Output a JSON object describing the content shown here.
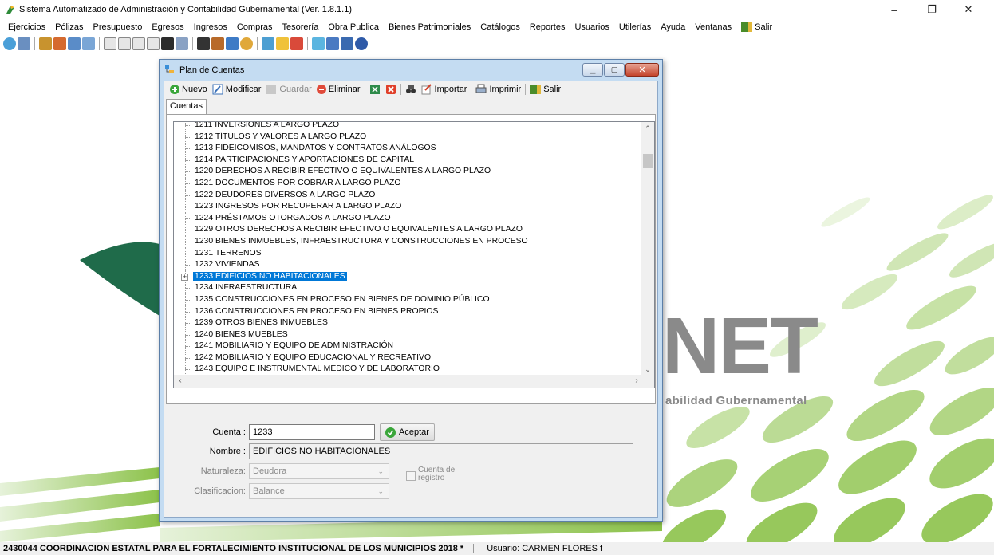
{
  "window": {
    "title": "Sistema Automatizado de Administración y Contabilidad Gubernamental (Ver. 1.8.1.1)"
  },
  "menu": [
    "Ejercicios",
    "Pólizas",
    "Presupuesto",
    "Egresos",
    "Ingresos",
    "Compras",
    "Tesorería",
    "Obra Publica",
    "Bienes Patrimoniales",
    "Catálogos",
    "Reportes",
    "Usuarios",
    "Utilerías",
    "Ayuda",
    "Ventanas"
  ],
  "menu_salir": "Salir",
  "background": {
    "brand_big": "NET",
    "brand_text": "abilidad Gubernamental"
  },
  "dialog": {
    "title": "Plan de Cuentas",
    "toolbar": {
      "nuevo": "Nuevo",
      "modificar": "Modificar",
      "guardar": "Guardar",
      "eliminar": "Eliminar",
      "importar": "Importar",
      "imprimir": "Imprimir",
      "salir": "Salir"
    },
    "tab": "Cuentas",
    "tree_rows": [
      "1211  INVERSIONES A LARGO PLAZO",
      "1212  TÍTULOS Y VALORES A LARGO PLAZO",
      "1213  FIDEICOMISOS, MANDATOS Y CONTRATOS ANÁLOGOS",
      "1214  PARTICIPACIONES Y APORTACIONES DE CAPITAL",
      "1220  DERECHOS A RECIBIR EFECTIVO O EQUIVALENTES A LARGO PLAZO",
      "1221  DOCUMENTOS POR COBRAR A LARGO PLAZO",
      "1222  DEUDORES DIVERSOS A LARGO PLAZO",
      "1223  INGRESOS POR RECUPERAR A LARGO PLAZO",
      "1224  PRÉSTAMOS OTORGADOS A LARGO PLAZO",
      "1229  OTROS DERECHOS A RECIBIR EFECTIVO O EQUIVALENTES A LARGO PLAZO",
      "1230  BIENES INMUEBLES, INFRAESTRUCTURA Y CONSTRUCCIONES EN PROCESO",
      "1231  TERRENOS",
      "1232  VIVIENDAS",
      "1233  EDIFICIOS NO HABITACIONALES",
      "1234  INFRAESTRUCTURA",
      "1235  CONSTRUCCIONES EN PROCESO EN BIENES DE DOMINIO PÚBLICO",
      "1236  CONSTRUCCIONES EN PROCESO EN BIENES PROPIOS",
      "1239  OTROS BIENES INMUEBLES",
      "1240  BIENES MUEBLES",
      "1241  MOBILIARIO Y EQUIPO DE ADMINISTRACIÓN",
      "1242  MOBILIARIO Y EQUIPO EDUCACIONAL Y RECREATIVO",
      "1243  EQUIPO E INSTRUMENTAL MÉDICO Y DE LABORATORIO"
    ],
    "selected_row": 13,
    "form": {
      "cuenta_label": "Cuenta :",
      "cuenta_value": "1233",
      "aceptar": "Aceptar",
      "nombre_label": "Nombre :",
      "nombre_value": "EDIFICIOS NO HABITACIONALES",
      "naturaleza_label": "Naturaleza:",
      "naturaleza_value": "Deudora",
      "clasificacion_label": "Clasificacion:",
      "clasificacion_value": "Balance",
      "cuenta_registro_label": "Cuenta de registro"
    }
  },
  "status": {
    "org": "2430044 COORDINACION ESTATAL PARA EL FORTALECIMIENTO INSTITUCIONAL DE LOS MUNICIPIOS  2018  *",
    "user": "Usuario: CARMEN FLORES f"
  },
  "colors": {
    "selection": "#0078d7",
    "dialog_frame": "#c4dcf2",
    "background_green": "#8cc24a",
    "brand_gray": "#8a8a8a"
  }
}
